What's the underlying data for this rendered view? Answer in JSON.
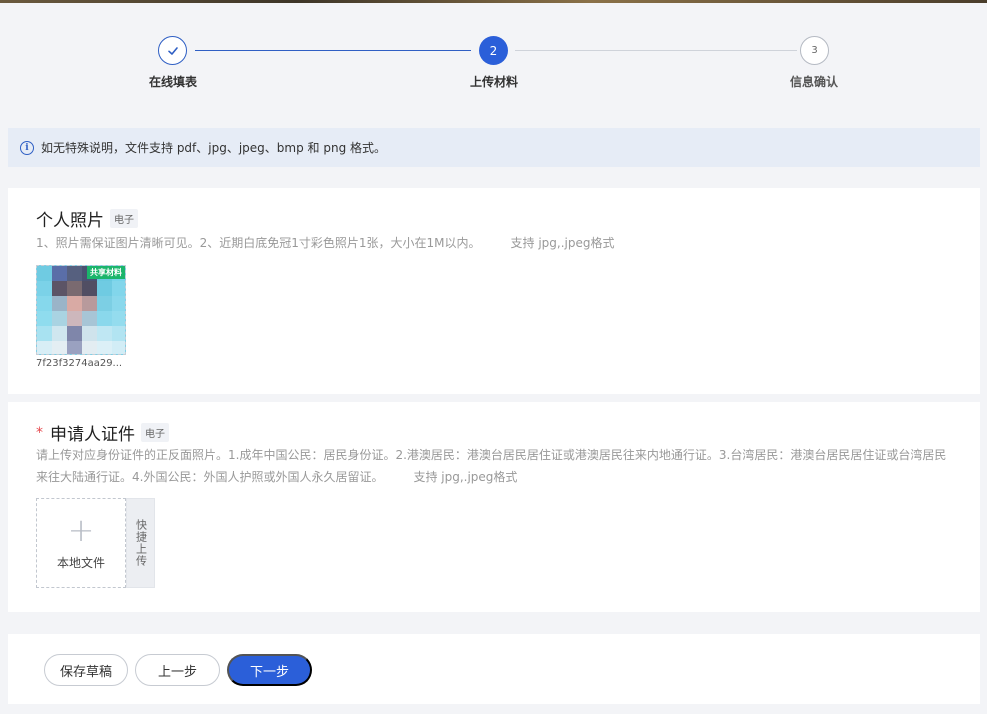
{
  "steps": [
    {
      "label": "在线填表",
      "status": "done",
      "marker": "✓"
    },
    {
      "label": "上传材料",
      "status": "active",
      "marker": "2"
    },
    {
      "label": "信息确认",
      "status": "pending",
      "marker": "3"
    }
  ],
  "notice": {
    "icon": "info-icon",
    "glyph": "i",
    "text": "如无特殊说明，文件支持 pdf、jpg、jpeg、bmp 和 png 格式。"
  },
  "personal_photo": {
    "title": "个人照片",
    "tag": "电子",
    "description": "1、照片需保证图片清晰可见。2、近期白底免冠1寸彩色照片1张，大小在1M以内。",
    "support": "支持 jpg,.jpeg格式",
    "file": {
      "name": "7f23f3274aa29...",
      "shared_tag": "共享材料"
    }
  },
  "applicant_id": {
    "required_mark": "*",
    "title": "申请人证件",
    "tag": "电子",
    "description": "请上传对应身份证件的正反面照片。1.成年中国公民：居民身份证。2.港澳居民：港澳台居民居住证或港澳居民往来内地通行证。3.台湾居民：港澳台居民居住证或台湾居民来往大陆通行证。4.外国公民：外国人护照或外国人永久居留证。",
    "support": "支持 jpg,.jpeg格式",
    "upload_icon": "+",
    "upload_label": "本地文件",
    "quick_upload_label": "快捷上传"
  },
  "footer": {
    "save_label": "保存草稿",
    "prev_label": "上一步",
    "next_label": "下一步"
  },
  "colors": {
    "primary": "#2b5fd9",
    "shared_tag": "#1bb56b",
    "required": "#e5484d",
    "notice_bg": "#e6ecf6"
  }
}
